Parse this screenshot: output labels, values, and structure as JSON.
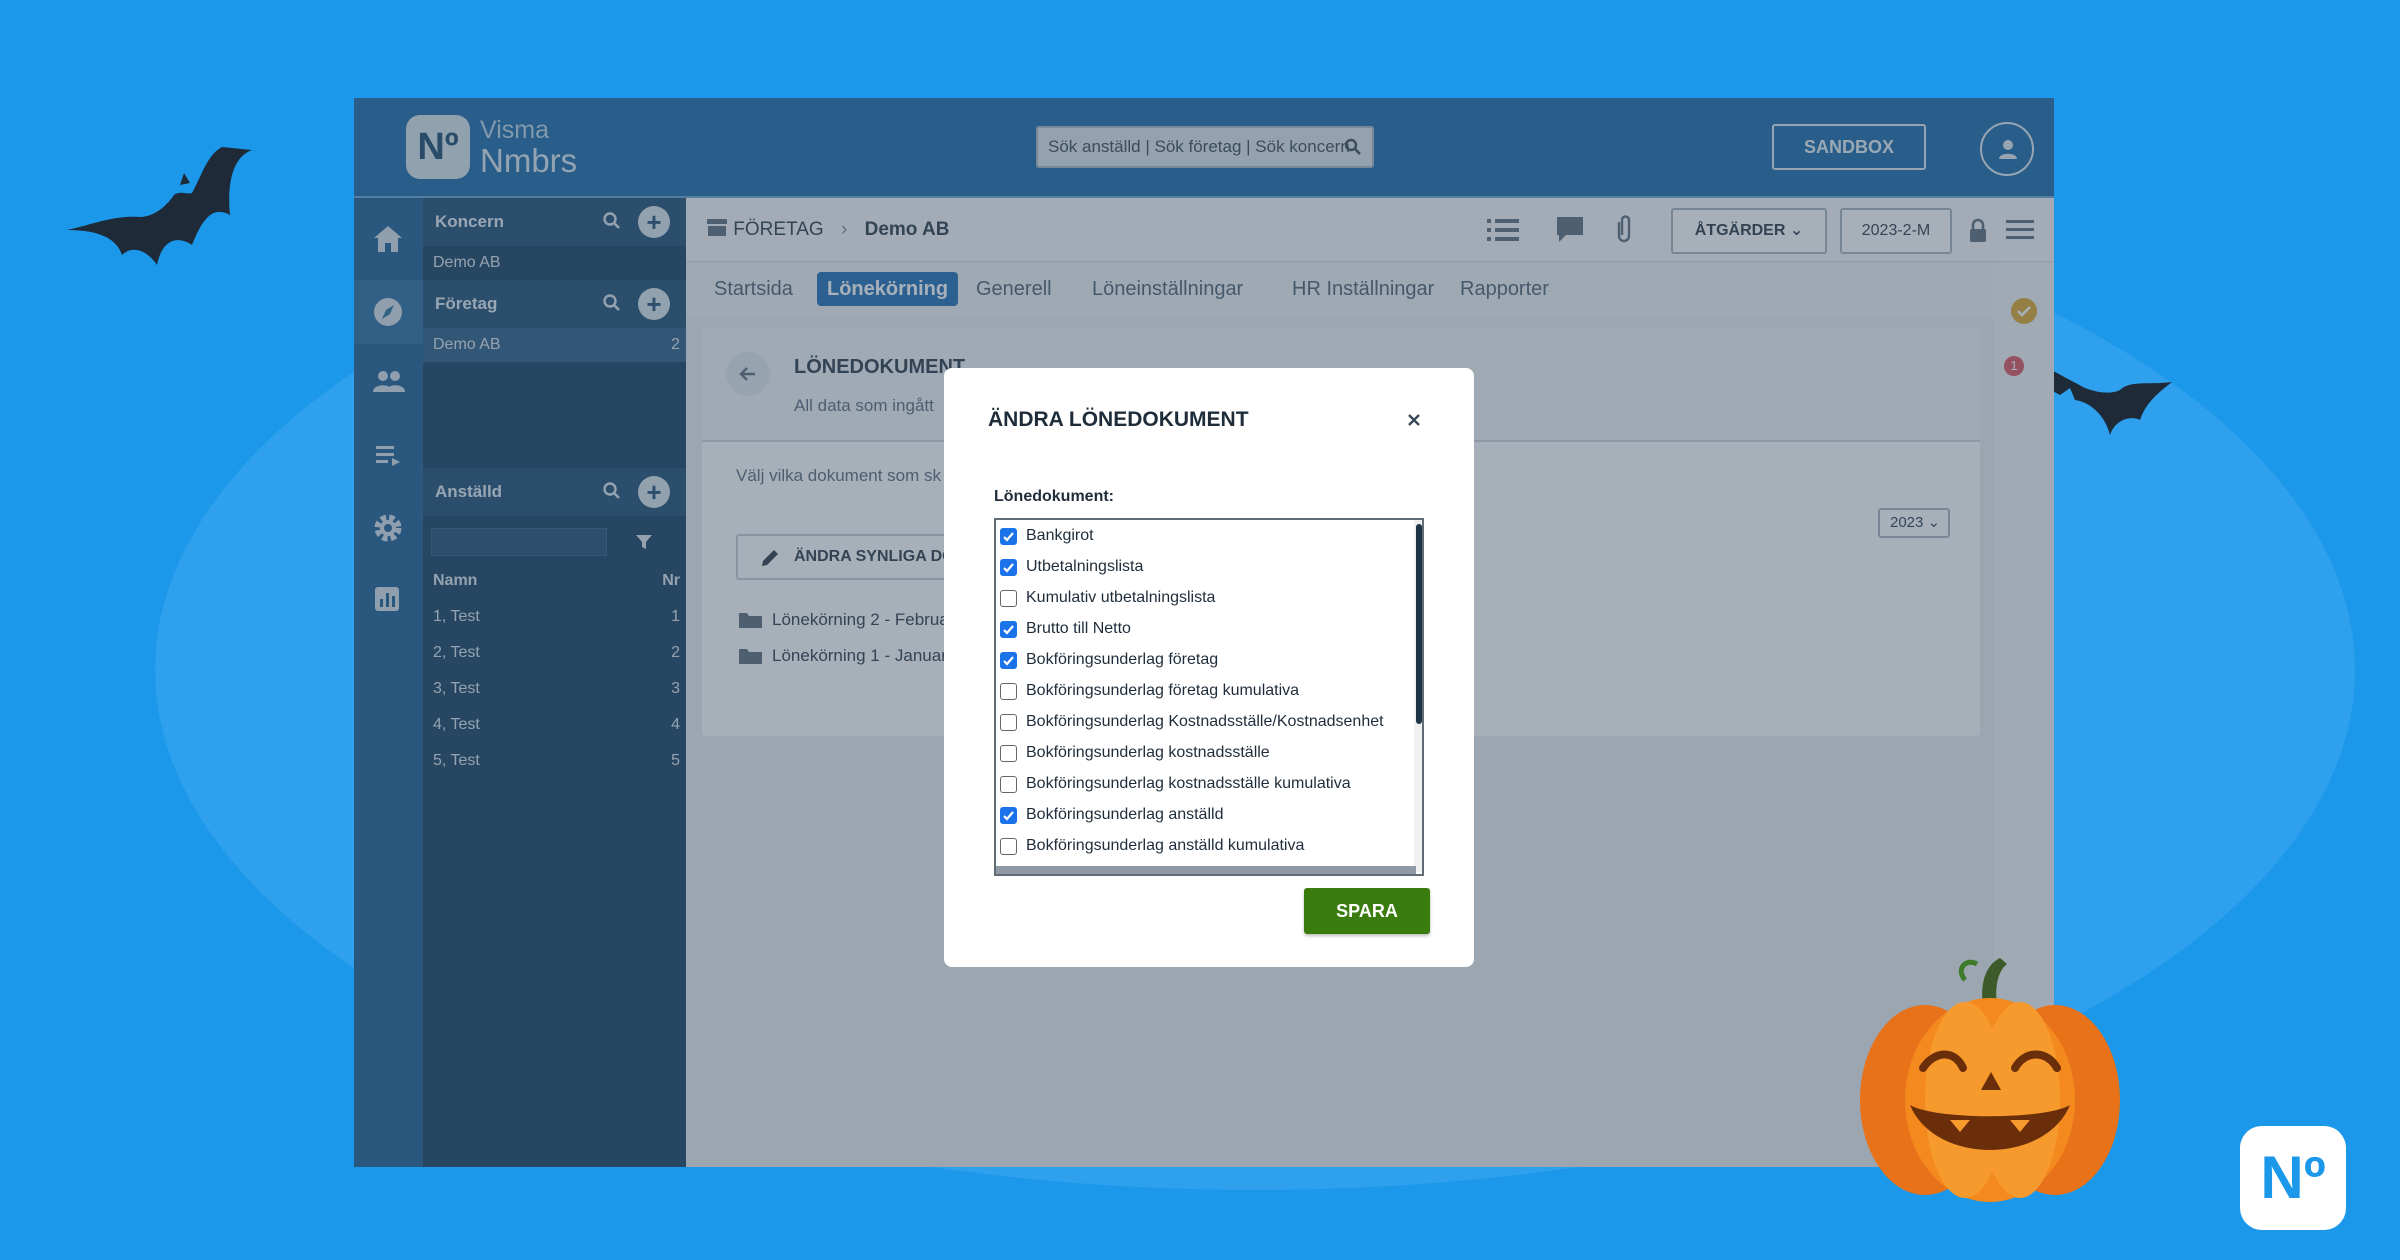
{
  "brand": {
    "logo_mark": "Nº",
    "line1": "Visma",
    "line2": "Nmbrs"
  },
  "search": {
    "placeholder": "Sök anställd | Sök företag | Sök koncern"
  },
  "topbar": {
    "sandbox": "SANDBOX"
  },
  "rail": [
    "home-icon",
    "compass-icon",
    "people-icon",
    "list-icon",
    "gear-icon",
    "chart-icon"
  ],
  "panel": {
    "koncern": {
      "title": "Koncern",
      "item": "Demo AB"
    },
    "foretag": {
      "title": "Företag",
      "item": "Demo AB",
      "count": "2"
    },
    "anstalld": {
      "title": "Anställd",
      "col_name": "Namn",
      "col_nr": "Nr",
      "rows": [
        {
          "name": "1, Test",
          "nr": "1"
        },
        {
          "name": "2, Test",
          "nr": "2"
        },
        {
          "name": "3, Test",
          "nr": "3"
        },
        {
          "name": "4, Test",
          "nr": "4"
        },
        {
          "name": "5, Test",
          "nr": "5"
        }
      ]
    }
  },
  "breadcrumb": {
    "section": "FÖRETAG",
    "current": "Demo AB"
  },
  "toolbar": {
    "actions": "ÅTGÄRDER",
    "period": "2023-2-M"
  },
  "tabs": [
    "Startsida",
    "Lönekörning",
    "Generell",
    "Löneinställningar",
    "HR Inställningar",
    "Rapporter"
  ],
  "card": {
    "title": "LÖNEDOKUMENT",
    "subtitle": "All data som ingått",
    "desc": "Välj vilka dokument som sk",
    "edit": "ÄNDRA SYNLIGA DOK",
    "year": "2023",
    "folders": [
      "Lönekörning 2 - Februa",
      "Lönekörning 1 - Januar"
    ]
  },
  "modal": {
    "title": "ÄNDRA LÖNEDOKUMENT",
    "label": "Lönedokument:",
    "save": "SPARA",
    "items": [
      {
        "label": "Bankgirot",
        "checked": true
      },
      {
        "label": "Utbetalningslista",
        "checked": true
      },
      {
        "label": "Kumulativ utbetalningslista",
        "checked": false
      },
      {
        "label": "Brutto till Netto",
        "checked": true
      },
      {
        "label": "Bokföringsunderlag företag",
        "checked": true
      },
      {
        "label": "Bokföringsunderlag företag kumulativa",
        "checked": false
      },
      {
        "label": "Bokföringsunderlag Kostnadsställe/Kostnadsenhet",
        "checked": false
      },
      {
        "label": "Bokföringsunderlag kostnadsställe",
        "checked": false
      },
      {
        "label": "Bokföringsunderlag kostnadsställe kumulativa",
        "checked": false
      },
      {
        "label": "Bokföringsunderlag anställd",
        "checked": true
      },
      {
        "label": "Bokföringsunderlag anställd kumulativa",
        "checked": false
      }
    ]
  },
  "notification": {
    "count": "1"
  },
  "colors": {
    "accent": "#1f6db5",
    "save": "#3a7d0e",
    "background": "#1b98ea"
  }
}
